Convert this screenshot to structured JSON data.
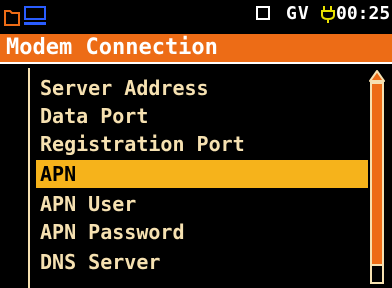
{
  "status_bar": {
    "icons": [
      "folder-icon",
      "monitor-icon",
      "empty-square-icon",
      "power-plug-icon"
    ],
    "mode": "GV",
    "time": "00:25"
  },
  "title": "Modem Connection",
  "menu": {
    "items": [
      {
        "label": "Server Address"
      },
      {
        "label": "Data Port"
      },
      {
        "label": "Registration Port"
      },
      {
        "label": "APN"
      },
      {
        "label": "APN User"
      },
      {
        "label": "APN Password"
      },
      {
        "label": "DNS Server"
      }
    ],
    "selected_index": 3
  },
  "scroll_position": 1.0,
  "colors": {
    "accent": "#ed6c16",
    "highlight": "#f6b31b",
    "text": "#f6e1b1",
    "background": "#000000"
  }
}
